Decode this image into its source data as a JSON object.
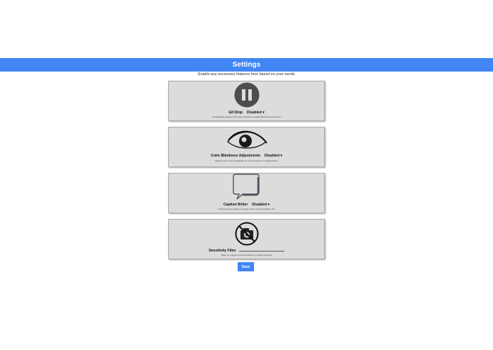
{
  "header": {
    "title": "Settings"
  },
  "subtitle": "Enable any necessary features here based on your needs",
  "features": [
    {
      "name": "Gif-Stop",
      "state": "Disabled",
      "description": "Automatically pauses GIF's and low-frame visually distracting animations"
    },
    {
      "name": "Color Blindness Adjustments",
      "state": "Disabled",
      "description": "Makes colors more identifiable for common types of colorblindness"
    },
    {
      "name": "Caption Writer",
      "state": "Disabled",
      "description": "Captions every image on a page with a word description of it"
    },
    {
      "name": "Sensitivity Filter",
      "description": "Filter out images and text related to sensitive subjects",
      "input_value": ""
    }
  ],
  "save_label": "Save",
  "icons": [
    "pause-icon",
    "eye-icon",
    "speech-bubble-icon",
    "no-camera-icon"
  ],
  "colors": {
    "accent": "#4285f4",
    "card": "#dedcda"
  }
}
